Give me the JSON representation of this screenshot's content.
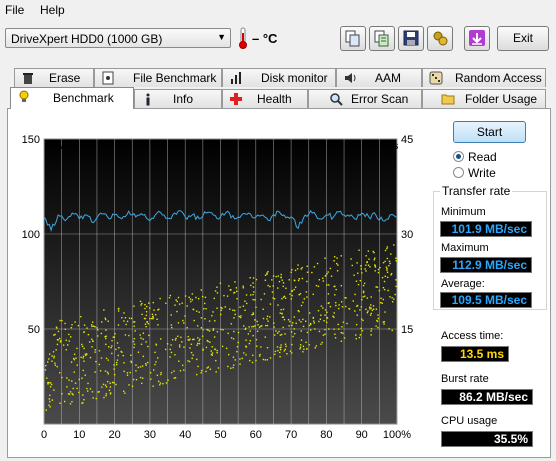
{
  "menu": {
    "file": "File",
    "help": "Help"
  },
  "toolbar": {
    "drive": "DriveXpert HDD0 (1000 GB)",
    "temperature": "– °C",
    "exit_label": "Exit",
    "buttons": [
      "copy-icon",
      "copy-text-icon",
      "save-icon",
      "settings-icon",
      "download-icon"
    ]
  },
  "tabs_top": [
    {
      "label": "Erase",
      "icon": "trash-icon"
    },
    {
      "label": "File Benchmark",
      "icon": "file-benchmark-icon"
    },
    {
      "label": "Disk monitor",
      "icon": "disk-monitor-icon"
    },
    {
      "label": "AAM",
      "icon": "speaker-icon"
    },
    {
      "label": "Random Access",
      "icon": "dice-icon"
    }
  ],
  "tabs_bottom": [
    {
      "label": "Benchmark",
      "icon": "bulb-icon",
      "active": true
    },
    {
      "label": "Info",
      "icon": "info-icon"
    },
    {
      "label": "Health",
      "icon": "health-icon"
    },
    {
      "label": "Error Scan",
      "icon": "magnifier-icon"
    },
    {
      "label": "Folder Usage",
      "icon": "folder-icon"
    }
  ],
  "controls": {
    "start_label": "Start",
    "read_label": "Read",
    "write_label": "Write",
    "selected": "Read"
  },
  "results": {
    "transfer_rate_title": "Transfer rate",
    "minimum_label": "Minimum",
    "minimum_value": "101.9 MB/sec",
    "maximum_label": "Maximum",
    "maximum_value": "112.9 MB/sec",
    "average_label": "Average:",
    "average_value": "109.5 MB/sec",
    "access_time_label": "Access time:",
    "access_time_value": "13.5 ms",
    "burst_rate_label": "Burst rate",
    "burst_rate_value": "86.2 MB/sec",
    "cpu_usage_label": "CPU usage",
    "cpu_usage_value": "35.5%"
  },
  "chart_data": {
    "type": "line",
    "left_unit": "MB/sec",
    "right_unit": "ms",
    "y_left_ticks": [
      "150",
      "100",
      "50"
    ],
    "y_right_ticks": [
      "45",
      "30",
      "15"
    ],
    "x_ticks": [
      "0",
      "10",
      "20",
      "30",
      "40",
      "50",
      "60",
      "70",
      "80",
      "90",
      "100%"
    ],
    "ylim_left": [
      0,
      150
    ],
    "ylim_right": [
      0,
      45
    ],
    "xlim": [
      0,
      100
    ],
    "series": [
      {
        "name": "Transfer rate",
        "color": "#3ea8e0",
        "axis": "left",
        "x": [
          0,
          2,
          4,
          6,
          8,
          10,
          12,
          14,
          16,
          18,
          20,
          22,
          24,
          26,
          28,
          30,
          32,
          34,
          36,
          38,
          40,
          42,
          44,
          46,
          48,
          50,
          52,
          54,
          56,
          58,
          60,
          62,
          64,
          66,
          68,
          70,
          72,
          74,
          76,
          78,
          80,
          82,
          84,
          86,
          88,
          90,
          92,
          94,
          96,
          98,
          100
        ],
        "y": [
          109,
          102,
          110,
          107,
          111,
          108,
          110,
          106,
          111,
          109,
          110,
          108,
          112,
          109,
          110,
          107,
          111,
          110,
          108,
          112,
          109,
          110,
          108,
          111,
          110,
          109,
          112,
          108,
          110,
          111,
          109,
          110,
          107,
          112,
          110,
          109,
          103,
          110,
          111,
          108,
          110,
          109,
          112,
          110,
          108,
          111,
          109,
          110,
          107,
          110,
          109
        ]
      },
      {
        "name": "Access time",
        "color": "#e6e600",
        "axis": "right",
        "style": "points",
        "trend_start": [
          0,
          9
        ],
        "trend_end": [
          100,
          22
        ],
        "spread": 7
      }
    ]
  }
}
